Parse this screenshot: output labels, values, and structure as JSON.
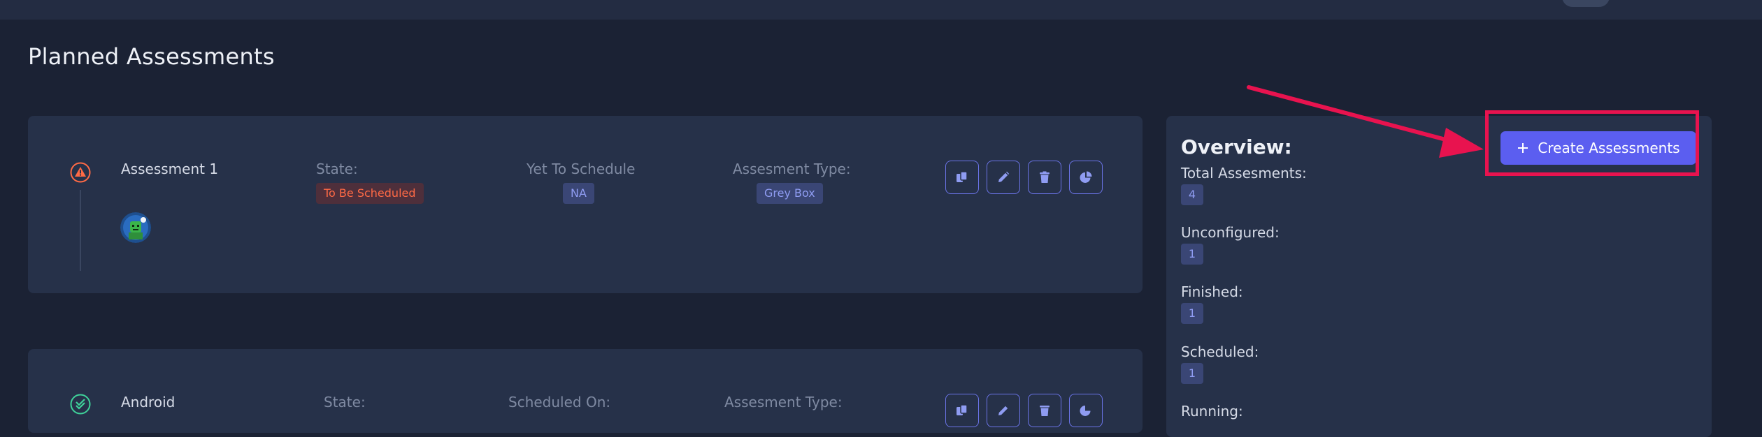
{
  "page": {
    "title": "Planned Assessments"
  },
  "assessments": [
    {
      "name": "Assessment 1",
      "status_icon": "warning-triangle-icon",
      "state_label": "State:",
      "state_value": "To Be Scheduled",
      "schedule_label": "Yet To Schedule",
      "schedule_value": "NA",
      "type_label": "Assesment Type:",
      "type_value": "Grey Box",
      "actions": [
        "copy-icon",
        "edit-icon",
        "delete-icon",
        "pie-chart-icon"
      ]
    },
    {
      "name": "Android",
      "status_icon": "check-circle-icon",
      "state_label": "State:",
      "schedule_label": "Scheduled On:",
      "type_label": "Assesment Type:",
      "actions": [
        "copy-icon",
        "edit-icon",
        "delete-icon",
        "pie-chart-icon"
      ]
    }
  ],
  "overview": {
    "title": "Overview:",
    "stats": [
      {
        "label": "Total Assesments:",
        "value": "4"
      },
      {
        "label": "Unconfigured:",
        "value": "1"
      },
      {
        "label": "Finished:",
        "value": "1"
      },
      {
        "label": "Scheduled:",
        "value": "1"
      },
      {
        "label": "Running:"
      }
    ],
    "create_button": "Create Assessments",
    "create_icon": "plus-icon"
  },
  "colors": {
    "background": "#1b2234",
    "card": "#263149",
    "accent": "#5b5ef0",
    "danger": "#ff6a45",
    "success": "#3fd29a",
    "annotation": "#e8134f"
  }
}
